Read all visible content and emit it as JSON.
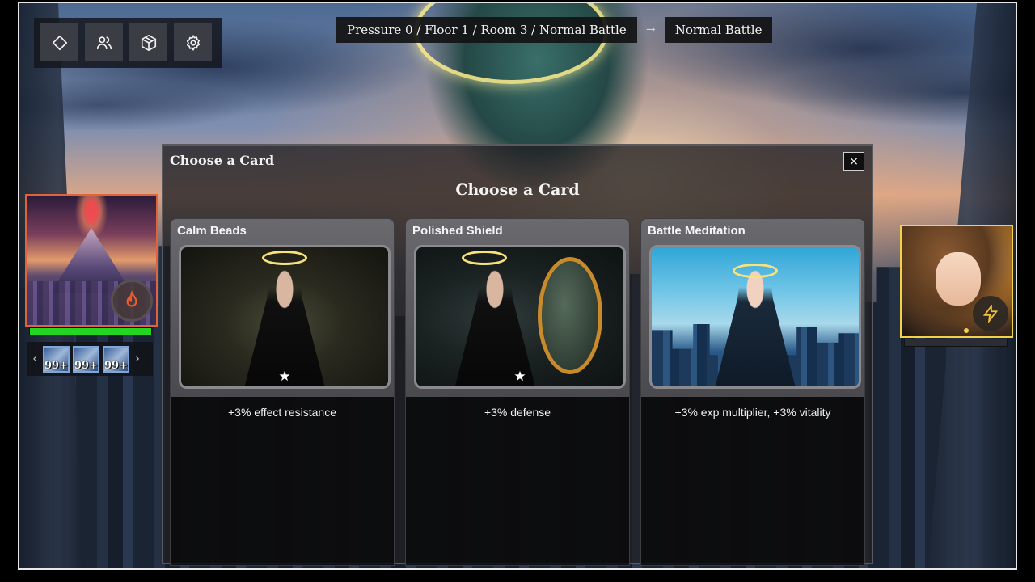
{
  "toolbar": {
    "buttons": [
      {
        "icon": "diamond-icon"
      },
      {
        "icon": "users-icon"
      },
      {
        "icon": "box-icon"
      },
      {
        "icon": "gear-icon"
      }
    ]
  },
  "breadcrumb": {
    "path": "Pressure 0 / Floor 1 / Room 3 / Normal Battle",
    "arrow": "→",
    "next": "Normal Battle"
  },
  "player": {
    "skill_icon": "flame-icon",
    "hp_fraction": 1.0,
    "hp_color": "#22d622",
    "items_prev": "‹",
    "items_next": "›",
    "items": [
      {
        "count": "99+"
      },
      {
        "count": "99+"
      },
      {
        "count": "99+"
      }
    ]
  },
  "enemy": {
    "skill_icon": "lightning-icon",
    "border_color": "#f3d24a"
  },
  "modal": {
    "title": "Choose a Card",
    "heading": "Choose a Card",
    "close": "×",
    "cards": [
      {
        "name": "Calm Beads",
        "desc": "+3% effect resistance",
        "star": "★"
      },
      {
        "name": "Polished Shield",
        "desc": "+3% defense",
        "star": "★"
      },
      {
        "name": "Battle Meditation",
        "desc": "+3% exp multiplier, +3% vitality",
        "star": ""
      }
    ]
  }
}
